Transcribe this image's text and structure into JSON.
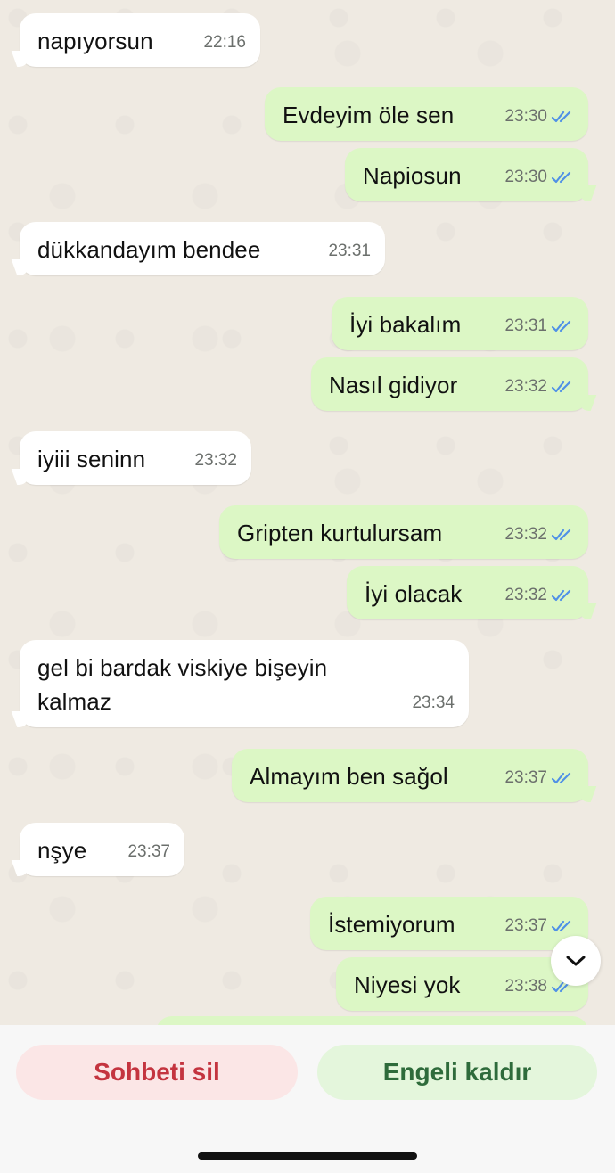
{
  "colors": {
    "incoming_bubble": "#ffffff",
    "outgoing_bubble": "#dcf7c5",
    "read_ticks": "#4f90e6",
    "delete_text": "#c4343f",
    "unblock_text": "#2e6b3b"
  },
  "messages": [
    {
      "direction": "in",
      "text": "napıyorsun",
      "time": "22:16"
    },
    {
      "direction": "out",
      "text": "Evdeyim öle sen",
      "time": "23:30",
      "status": "read"
    },
    {
      "direction": "out",
      "text": "Napiosun",
      "time": "23:30",
      "status": "read"
    },
    {
      "direction": "in",
      "text": "dükkandayım bendee",
      "time": "23:31"
    },
    {
      "direction": "out",
      "text": "İyi bakalım",
      "time": "23:31",
      "status": "read"
    },
    {
      "direction": "out",
      "text": "Nasıl gidiyor",
      "time": "23:32",
      "status": "read"
    },
    {
      "direction": "in",
      "text": "iyiii seninn",
      "time": "23:32"
    },
    {
      "direction": "out",
      "text": "Gripten kurtulursam",
      "time": "23:32",
      "status": "read"
    },
    {
      "direction": "out",
      "text": "İyi olacak",
      "time": "23:32",
      "status": "read"
    },
    {
      "direction": "in",
      "text": "gel bi bardak viskiye bişeyin kalmaz",
      "time": "23:34"
    },
    {
      "direction": "out",
      "text": "Almayım ben sağol",
      "time": "23:37",
      "status": "read"
    },
    {
      "direction": "in",
      "text": "nşye",
      "time": "23:37"
    },
    {
      "direction": "out",
      "text": "İstemiyorum",
      "time": "23:37",
      "status": "read"
    },
    {
      "direction": "out",
      "text": "Niyesi yok",
      "time": "23:38",
      "status": "read"
    }
  ],
  "scroll_button": {
    "icon": "chevron-down-icon"
  },
  "actions": {
    "delete_chat_label": "Sohbeti sil",
    "unblock_label": "Engeli kaldır"
  }
}
